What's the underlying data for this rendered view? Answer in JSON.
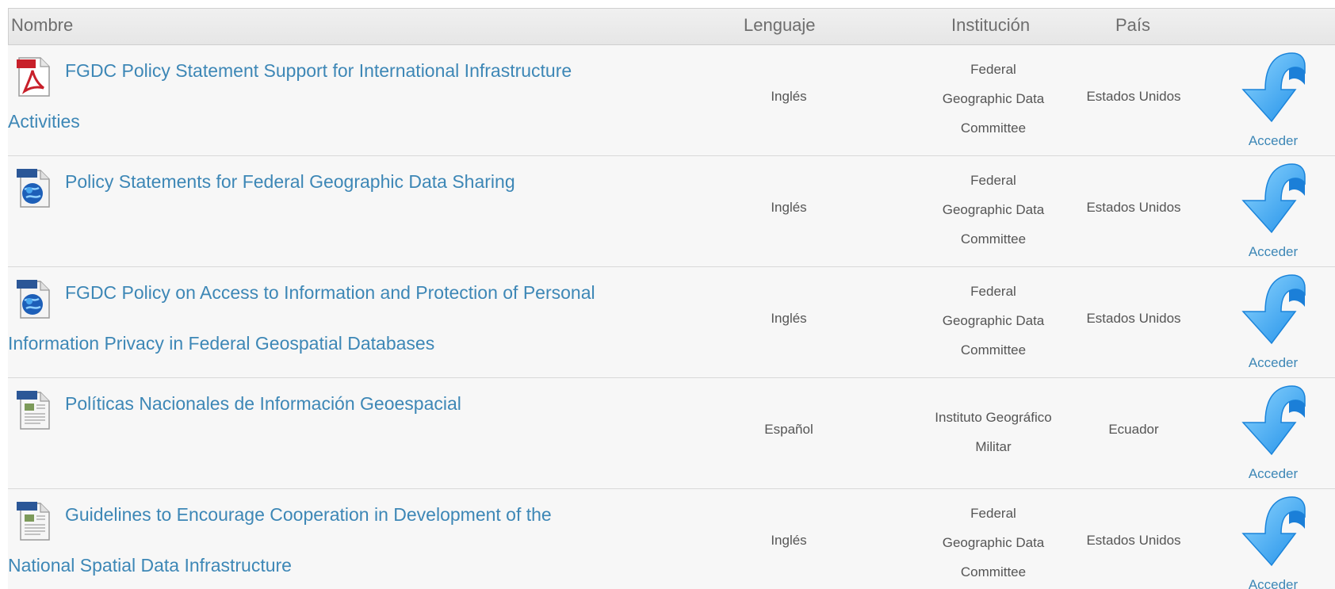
{
  "header": {
    "name": "Nombre",
    "language": "Lenguaje",
    "institution": "Institución",
    "country": "País"
  },
  "rows": [
    {
      "icon": "pdf-file-icon",
      "title_line1": "FGDC Policy Statement Support for International Infrastructure",
      "title_line2": "Activities",
      "language": "Inglés",
      "institution_lines": [
        "Federal",
        "Geographic Data",
        "Committee"
      ],
      "country": "Estados Unidos",
      "action": "Acceder"
    },
    {
      "icon": "html-file-icon",
      "title_line1": "Policy Statements for Federal Geographic Data Sharing",
      "title_line2": "",
      "language": "Inglés",
      "institution_lines": [
        "Federal",
        "Geographic Data",
        "Committee"
      ],
      "country": "Estados Unidos",
      "action": "Acceder"
    },
    {
      "icon": "html-file-icon",
      "title_line1": "FGDC Policy on Access to Information and Protection of Personal",
      "title_line2": "Information Privacy in Federal Geospatial Databases",
      "language": "Inglés",
      "institution_lines": [
        "Federal",
        "Geographic Data",
        "Committee"
      ],
      "country": "Estados Unidos",
      "action": "Acceder"
    },
    {
      "icon": "word-file-icon",
      "title_line1": "Políticas Nacionales de Información Geoespacial",
      "title_line2": "",
      "language": "Español",
      "institution_lines": [
        "Instituto Geográfico",
        "Militar"
      ],
      "country": "Ecuador",
      "action": "Acceder"
    },
    {
      "icon": "word-file-icon",
      "title_line1": "Guidelines to Encourage Cooperation in Development of the",
      "title_line2": "National Spatial Data Infrastructure",
      "language": "Inglés",
      "institution_lines": [
        "Federal",
        "Geographic Data",
        "Committee"
      ],
      "country": "Estados Unidos",
      "action": "Acceder"
    }
  ],
  "colors": {
    "link": "#3d87b6",
    "arrow": "#2c9bf0",
    "pdf": "#c8202a",
    "word": "#2b5797",
    "html_globe": "#1d5fb8"
  }
}
